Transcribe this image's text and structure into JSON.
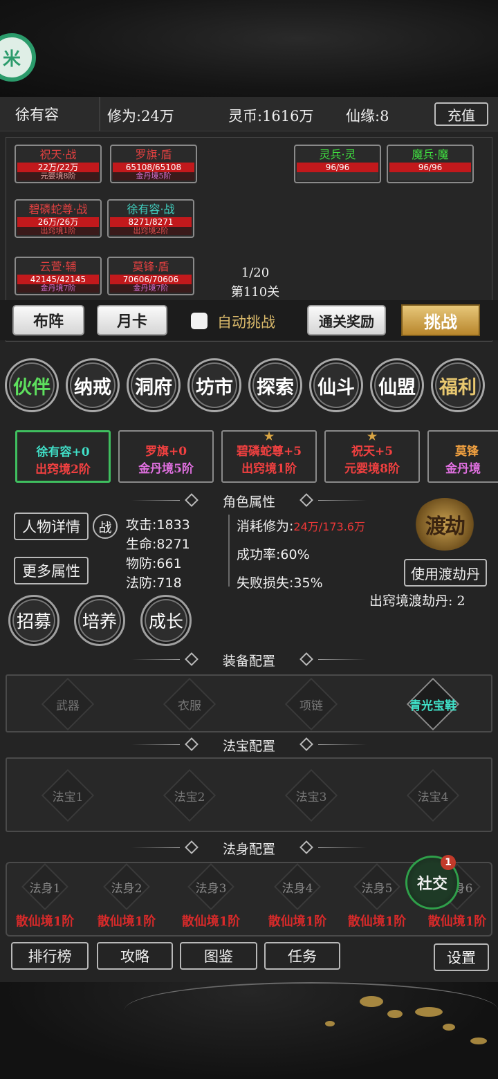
{
  "topbar": {
    "name": "徐有容",
    "cultivation": "修为:24万",
    "spirit_coin": "灵币:1616万",
    "fate": "仙缘:8",
    "recharge": "充值"
  },
  "battle": {
    "units": [
      {
        "name": "祝天·战",
        "hp": "22万/22万",
        "realm": "元婴境8阶",
        "name_color": "#e04040",
        "realm_color": "#e0a0a0"
      },
      {
        "name": "罗旗·盾",
        "hp": "65108/65108",
        "realm": "金丹境5阶",
        "name_color": "#e04040",
        "realm_color": "#d070d0"
      },
      {
        "name": "碧磷蛇尊·战",
        "hp": "26万/26万",
        "realm": "出窍境1阶",
        "name_color": "#e04040",
        "realm_color": "#e05050"
      },
      {
        "name": "徐有容·战",
        "hp": "8271/8271",
        "realm": "出窍境2阶",
        "name_color": "#40d0c0",
        "realm_color": "#e05050"
      },
      {
        "name": "云萱·辅",
        "hp": "42145/42145",
        "realm": "金丹境7阶",
        "name_color": "#e04040",
        "realm_color": "#d070d0"
      },
      {
        "name": "莫锋·盾",
        "hp": "70606/70606",
        "realm": "金丹境7阶",
        "name_color": "#e04040",
        "realm_color": "#d070d0"
      },
      {
        "name": "灵兵·灵",
        "hp": "96/96",
        "realm": "",
        "name_color": "#40e040",
        "realm_color": "#888"
      },
      {
        "name": "魔兵·魔",
        "hp": "96/96",
        "realm": "",
        "name_color": "#40e040",
        "realm_color": "#888"
      }
    ],
    "wave": "1/20",
    "stage": "第110关"
  },
  "actions": {
    "formation": "布阵",
    "monthly_card": "月卡",
    "auto_challenge": "自动挑战",
    "clear_reward": "通关奖励",
    "challenge": "挑战",
    "auto_checked": false
  },
  "nav": [
    "伙伴",
    "纳戒",
    "洞府",
    "坊市",
    "探索",
    "仙斗",
    "仙盟",
    "福利"
  ],
  "nav_active": "伙伴",
  "partners": [
    {
      "name": "徐有容+0",
      "realm": "出窍境2阶",
      "name_color": "#40e0c8",
      "realm_color": "#f04040",
      "star": "",
      "selected": true
    },
    {
      "name": "罗旗+0",
      "realm": "金丹境5阶",
      "name_color": "#f04040",
      "realm_color": "#e070e0",
      "star": "",
      "selected": false
    },
    {
      "name": "碧磷蛇尊+5",
      "realm": "出窍境1阶",
      "name_color": "#f04040",
      "realm_color": "#f04040",
      "star": "★",
      "selected": false
    },
    {
      "name": "祝天+5",
      "realm": "元婴境8阶",
      "name_color": "#f04040",
      "realm_color": "#f04040",
      "star": "★",
      "selected": false
    },
    {
      "name": "莫锋",
      "realm": "金丹境",
      "name_color": "#f0a040",
      "realm_color": "#e070e0",
      "star": "",
      "selected": false
    }
  ],
  "attributes": {
    "title": "角色属性",
    "detail_btn": "人物详情",
    "battle_tag": "战",
    "more_btn": "更多属性",
    "attack": "攻击:1833",
    "hp": "生命:8271",
    "pdef": "物防:661",
    "mdef": "法防:718",
    "cost_label": "消耗修为:",
    "cost_value": "24万/173.6万",
    "success": "成功率:60%",
    "fail_loss": "失败损失:35%",
    "tribulation_icon": "渡劫",
    "use_pill_btn": "使用渡劫丹",
    "pill_count": "出窍境渡劫丹: 2"
  },
  "growth": [
    "招募",
    "培养",
    "成长"
  ],
  "equipment": {
    "title": "装备配置",
    "slots": [
      "武器",
      "衣服",
      "项链",
      "青光宝鞋"
    ]
  },
  "treasure": {
    "title": "法宝配置",
    "slots": [
      "法宝1",
      "法宝2",
      "法宝3",
      "法宝4"
    ]
  },
  "dharma": {
    "title": "法身配置",
    "slots": [
      {
        "name": "法身1",
        "level": "散仙境1阶"
      },
      {
        "name": "法身2",
        "level": "散仙境1阶"
      },
      {
        "name": "法身3",
        "level": "散仙境1阶"
      },
      {
        "name": "法身4",
        "level": "散仙境1阶"
      },
      {
        "name": "法身5",
        "level": "散仙境1阶"
      },
      {
        "name": "法身6",
        "level": "散仙境1阶"
      }
    ]
  },
  "social": {
    "label": "社交",
    "badge": "1"
  },
  "bottom_nav": {
    "ranking": "排行榜",
    "guide": "攻略",
    "codex": "图鉴",
    "quest": "任务",
    "settings": "设置"
  },
  "mi_logo": "米"
}
